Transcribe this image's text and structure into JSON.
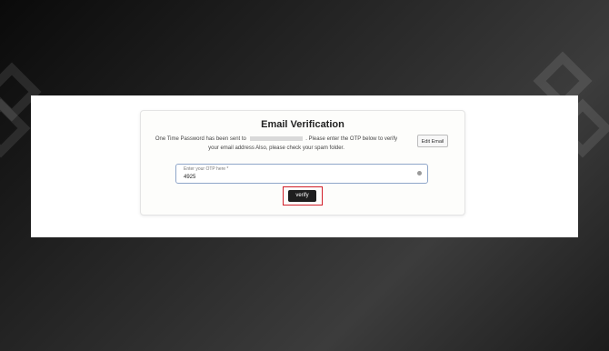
{
  "dialog": {
    "title": "Email Verification",
    "message_before_email": "One Time Password has been sent to",
    "message_after_email": ". Please enter the OTP below to verify your email address Also, please check your spam folder.",
    "edit_button_label": "Edit Email"
  },
  "otp": {
    "label": "Enter your OTP here *",
    "value": "4925"
  },
  "verify": {
    "label": "verify",
    "highlight_color": "#d21f2a"
  },
  "theme": {
    "button_bg": "#1e1e1e",
    "input_border": "#8fa6c9"
  }
}
